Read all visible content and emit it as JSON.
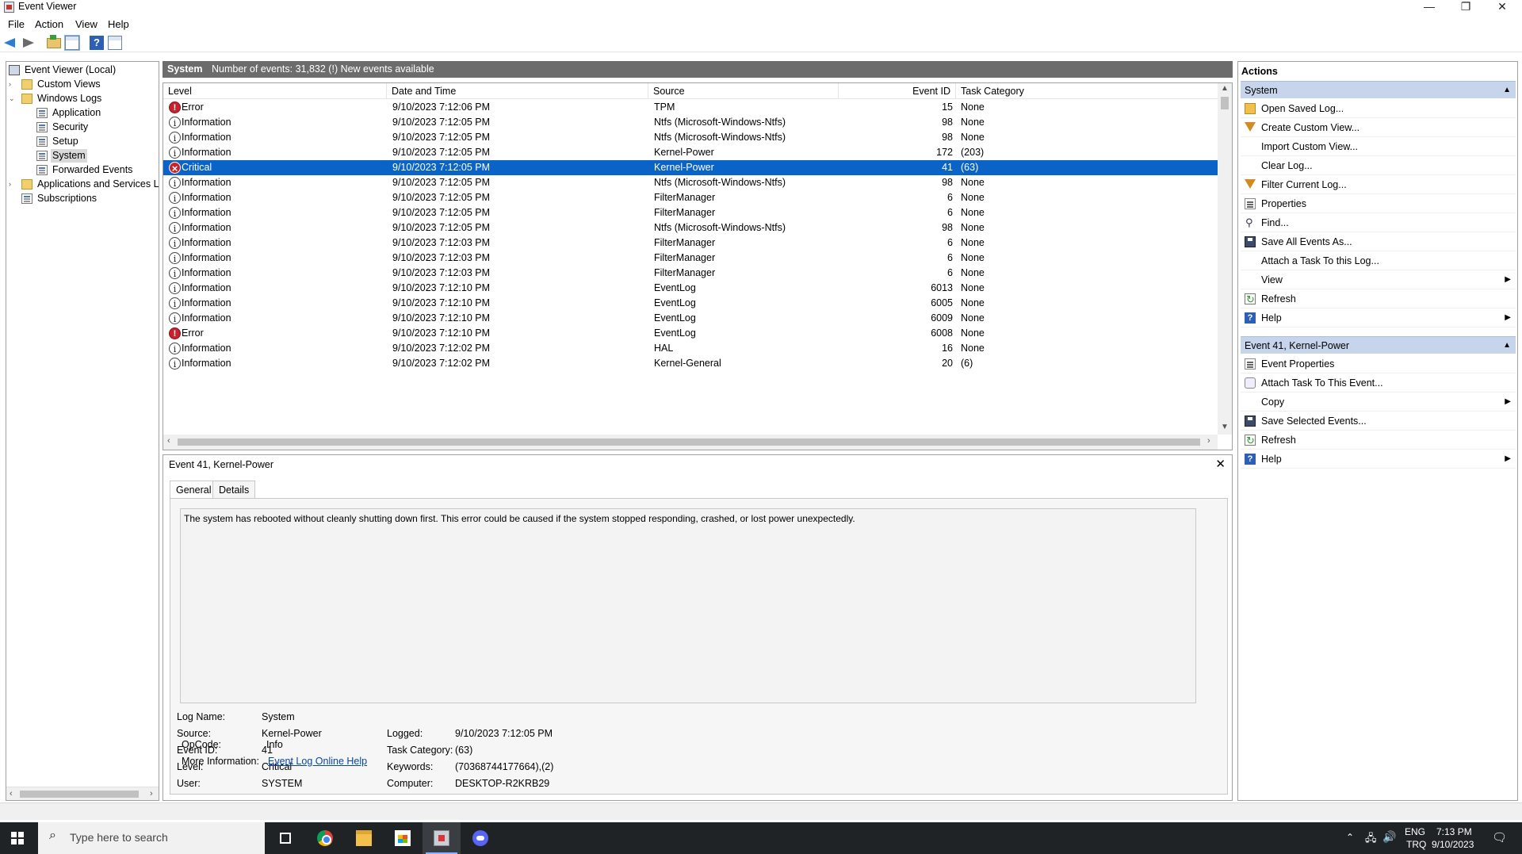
{
  "window": {
    "title": "Event Viewer",
    "min": "—",
    "max": "❐",
    "close": "✕"
  },
  "menu": [
    "File",
    "Action",
    "View",
    "Help"
  ],
  "nav": {
    "items": [
      {
        "label": "Event Viewer (Local)",
        "icon": "computer-icon"
      },
      {
        "label": "Custom Views",
        "icon": "folder-icon",
        "twisty": "›"
      },
      {
        "label": "Windows Logs",
        "icon": "folder-icon",
        "twisty": "⌄"
      },
      {
        "label": "Application",
        "icon": "log-icon"
      },
      {
        "label": "Security",
        "icon": "log-icon"
      },
      {
        "label": "Setup",
        "icon": "log-icon"
      },
      {
        "label": "System",
        "icon": "log-icon"
      },
      {
        "label": "Forwarded Events",
        "icon": "log-icon"
      },
      {
        "label": "Applications and Services Lo",
        "icon": "folder-icon",
        "twisty": "›"
      },
      {
        "label": "Subscriptions",
        "icon": "log-icon"
      }
    ],
    "selected": "System"
  },
  "log_header": {
    "name": "System",
    "count": "Number of events: 31,832 (!) New events available"
  },
  "grid": {
    "columns": [
      "Level",
      "Date and Time",
      "Source",
      "Event ID",
      "Task Category"
    ],
    "rows": [
      {
        "level": "Error",
        "date": "9/10/2023 7:12:06 PM",
        "source": "TPM",
        "id": "15",
        "cat": "None"
      },
      {
        "level": "Information",
        "date": "9/10/2023 7:12:05 PM",
        "source": "Ntfs (Microsoft-Windows-Ntfs)",
        "id": "98",
        "cat": "None"
      },
      {
        "level": "Information",
        "date": "9/10/2023 7:12:05 PM",
        "source": "Ntfs (Microsoft-Windows-Ntfs)",
        "id": "98",
        "cat": "None"
      },
      {
        "level": "Information",
        "date": "9/10/2023 7:12:05 PM",
        "source": "Kernel-Power",
        "id": "172",
        "cat": "(203)"
      },
      {
        "level": "Critical",
        "date": "9/10/2023 7:12:05 PM",
        "source": "Kernel-Power",
        "id": "41",
        "cat": "(63)"
      },
      {
        "level": "Information",
        "date": "9/10/2023 7:12:05 PM",
        "source": "Ntfs (Microsoft-Windows-Ntfs)",
        "id": "98",
        "cat": "None"
      },
      {
        "level": "Information",
        "date": "9/10/2023 7:12:05 PM",
        "source": "FilterManager",
        "id": "6",
        "cat": "None"
      },
      {
        "level": "Information",
        "date": "9/10/2023 7:12:05 PM",
        "source": "FilterManager",
        "id": "6",
        "cat": "None"
      },
      {
        "level": "Information",
        "date": "9/10/2023 7:12:05 PM",
        "source": "Ntfs (Microsoft-Windows-Ntfs)",
        "id": "98",
        "cat": "None"
      },
      {
        "level": "Information",
        "date": "9/10/2023 7:12:03 PM",
        "source": "FilterManager",
        "id": "6",
        "cat": "None"
      },
      {
        "level": "Information",
        "date": "9/10/2023 7:12:03 PM",
        "source": "FilterManager",
        "id": "6",
        "cat": "None"
      },
      {
        "level": "Information",
        "date": "9/10/2023 7:12:03 PM",
        "source": "FilterManager",
        "id": "6",
        "cat": "None"
      },
      {
        "level": "Information",
        "date": "9/10/2023 7:12:10 PM",
        "source": "EventLog",
        "id": "6013",
        "cat": "None"
      },
      {
        "level": "Information",
        "date": "9/10/2023 7:12:10 PM",
        "source": "EventLog",
        "id": "6005",
        "cat": "None"
      },
      {
        "level": "Information",
        "date": "9/10/2023 7:12:10 PM",
        "source": "EventLog",
        "id": "6009",
        "cat": "None"
      },
      {
        "level": "Error",
        "date": "9/10/2023 7:12:10 PM",
        "source": "EventLog",
        "id": "6008",
        "cat": "None"
      },
      {
        "level": "Information",
        "date": "9/10/2023 7:12:02 PM",
        "source": "HAL",
        "id": "16",
        "cat": "None"
      },
      {
        "level": "Information",
        "date": "9/10/2023 7:12:02 PM",
        "source": "Kernel-General",
        "id": "20",
        "cat": "(6)"
      }
    ],
    "selected_row": 4
  },
  "detail": {
    "title": "Event 41, Kernel-Power",
    "tabs": [
      "General",
      "Details"
    ],
    "description": "The system has rebooted without cleanly shutting down first. This error could be caused if the system stopped responding, crashed, or lost power unexpectedly.",
    "props_left": [
      {
        "label": "Log Name:",
        "value": "System"
      },
      {
        "label": "Source:",
        "value": "Kernel-Power"
      },
      {
        "label": "Event ID:",
        "value": "41"
      },
      {
        "label": "Level:",
        "value": "Critical"
      },
      {
        "label": "User:",
        "value": "SYSTEM"
      },
      {
        "label": "OpCode:",
        "value": "Info"
      },
      {
        "label": "More Information:",
        "value": "Event Log Online Help"
      }
    ],
    "props_right": [
      {
        "label": "Logged:",
        "value": "9/10/2023 7:12:05 PM"
      },
      {
        "label": "Task Category:",
        "value": "(63)"
      },
      {
        "label": "Keywords:",
        "value": "(70368744177664),(2)"
      },
      {
        "label": "Computer:",
        "value": "DESKTOP-R2KRB29"
      }
    ]
  },
  "actions": {
    "title": "Actions",
    "section1": "System",
    "items1": [
      {
        "label": "Open Saved Log...",
        "icon": "open"
      },
      {
        "label": "Create Custom View...",
        "icon": "filter"
      },
      {
        "label": "Import Custom View...",
        "icon": ""
      },
      {
        "label": "Clear Log...",
        "icon": ""
      },
      {
        "label": "Filter Current Log...",
        "icon": "filter"
      },
      {
        "label": "Properties",
        "icon": "props"
      },
      {
        "label": "Find...",
        "icon": "find"
      },
      {
        "label": "Save All Events As...",
        "icon": "save"
      },
      {
        "label": "Attach a Task To this Log...",
        "icon": ""
      },
      {
        "label": "View",
        "icon": "",
        "sub": true
      },
      {
        "label": "Refresh",
        "icon": "refresh"
      },
      {
        "label": "Help",
        "icon": "help",
        "sub": true
      }
    ],
    "section2": "Event 41, Kernel-Power",
    "items2": [
      {
        "label": "Event Properties",
        "icon": "props"
      },
      {
        "label": "Attach Task To This Event...",
        "icon": "task"
      },
      {
        "label": "Copy",
        "icon": "",
        "sub": true
      },
      {
        "label": "Save Selected Events...",
        "icon": "save"
      },
      {
        "label": "Refresh",
        "icon": "refresh"
      },
      {
        "label": "Help",
        "icon": "help",
        "sub": true
      }
    ]
  },
  "taskbar": {
    "search_placeholder": "Type here to search",
    "lang": "ENG",
    "layout": "TRQ",
    "time": "7:13 PM",
    "date": "9/10/2023"
  },
  "colors": {
    "selection": "#0a64c8",
    "section": "#c6d5eb",
    "header": "#6c6c6c",
    "taskbar": "#202326"
  }
}
